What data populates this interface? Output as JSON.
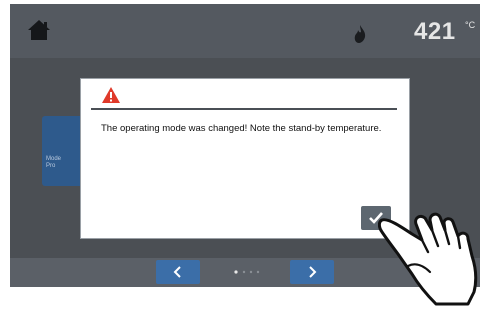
{
  "header": {
    "home_icon": "home-icon",
    "flame_icon": "flame-icon",
    "temperature_value": "421",
    "temperature_unit": "°C"
  },
  "background_tile": {
    "lines": [
      "Mode",
      "Pro"
    ]
  },
  "dialog": {
    "icon": "warning-icon",
    "message": "The operating mode was changed! Note the stand-by temperature.",
    "confirm_icon": "checkmark-icon"
  },
  "footer": {
    "prev_icon": "chevron-left-icon",
    "next_icon": "chevron-right-icon",
    "page_indicator_icon": "page-dots-icon"
  },
  "colors": {
    "screen_bg": "#4b4f54",
    "accent_blue": "#3b6ea8",
    "warning_red": "#e03a2a"
  }
}
